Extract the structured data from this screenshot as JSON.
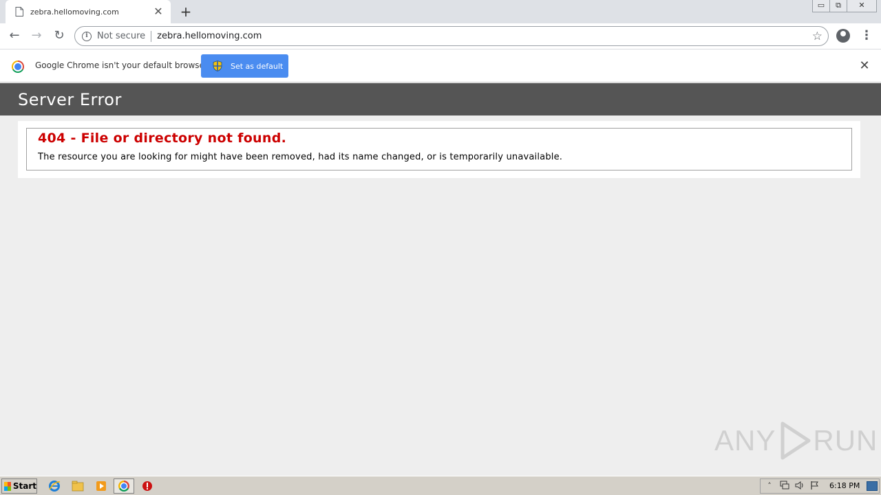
{
  "browser": {
    "tab": {
      "title": "zebra.hellomoving.com",
      "close": "✕"
    },
    "new_tab": "+",
    "window_controls": {
      "minimize": "▭",
      "restore": "⧉",
      "close": "✕"
    },
    "nav": {
      "back": "←",
      "forward": "→",
      "reload": "↻",
      "menu": "⋮"
    },
    "omnibox": {
      "security_label": "Not secure",
      "url": "zebra.hellomoving.com",
      "info_glyph": "i",
      "star": "☆"
    }
  },
  "infobar": {
    "message": "Google Chrome isn't your default browser",
    "button_label": "Set as default",
    "close": "✕"
  },
  "page": {
    "header_title": "Server Error",
    "error_title": "404 - File or directory not found.",
    "error_message": "The resource you are looking for might have been removed, had its name changed, or is temporarily unavailable."
  },
  "watermark": {
    "left": "ANY",
    "right": "RUN"
  },
  "taskbar": {
    "start_label": "Start",
    "clock": "6:18 PM",
    "tray_icons": [
      "chevron-up-icon",
      "network-icon",
      "speaker-icon",
      "flag-icon"
    ]
  },
  "colors": {
    "error_red": "#cc0000",
    "header_gray": "#555555",
    "button_blue": "#4a8cf0"
  }
}
